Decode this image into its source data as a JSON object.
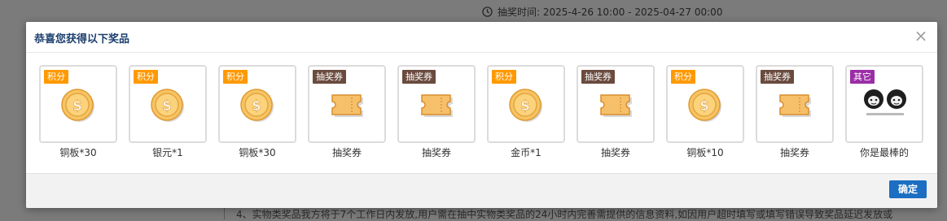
{
  "background": {
    "draw_time": "抽奖时间: 2025-4-26 10:00 - 2025-04-27 00:00",
    "notice": "4、实物类奖品我方将于7个工作日内发放,用户需在抽中实物类奖品的24小时内完善需提供的信息资料,如因用户超时填写或填写错误导致奖品延迟发放或"
  },
  "modal": {
    "title": "恭喜您获得以下奖品",
    "close_symbol": "×",
    "confirm_label": "确定",
    "prizes": [
      {
        "tag": "积分",
        "tag_type": "points",
        "icon": "coin-icon",
        "name": "铜板*30"
      },
      {
        "tag": "积分",
        "tag_type": "points",
        "icon": "coin-icon",
        "name": "银元*1"
      },
      {
        "tag": "积分",
        "tag_type": "points",
        "icon": "coin-icon",
        "name": "铜板*30"
      },
      {
        "tag": "抽奖券",
        "tag_type": "ticket",
        "icon": "ticket-icon",
        "name": "抽奖券"
      },
      {
        "tag": "抽奖券",
        "tag_type": "ticket",
        "icon": "ticket-icon",
        "name": "抽奖券"
      },
      {
        "tag": "积分",
        "tag_type": "points",
        "icon": "coin-icon",
        "name": "金币*1"
      },
      {
        "tag": "抽奖券",
        "tag_type": "ticket",
        "icon": "ticket-icon",
        "name": "抽奖券"
      },
      {
        "tag": "积分",
        "tag_type": "points",
        "icon": "coin-icon",
        "name": "铜板*10"
      },
      {
        "tag": "抽奖券",
        "tag_type": "ticket",
        "icon": "ticket-icon",
        "name": "抽奖券"
      },
      {
        "tag": "其它",
        "tag_type": "other",
        "icon": "meme-image",
        "name": "你是最棒的"
      }
    ]
  },
  "colors": {
    "points_tag": "#ff9900",
    "ticket_tag": "#6a4b3e",
    "other_tag": "#9b2ea6",
    "confirm_button": "#1b6ec2",
    "title_text": "#1c3f6e"
  }
}
